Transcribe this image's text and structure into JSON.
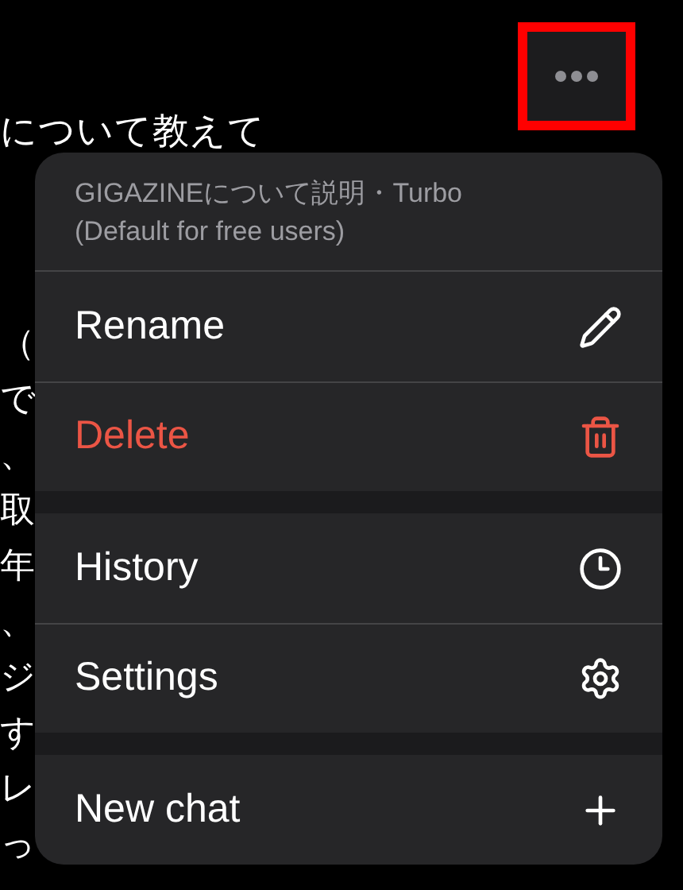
{
  "background_text": {
    "lines": [
      "について教えて",
      "（",
      "で",
      "、",
      "取",
      "年",
      "、",
      "ジ",
      "す",
      "レ",
      "っ"
    ]
  },
  "more_button": {
    "highlighted": true
  },
  "menu": {
    "header": {
      "title": "GIGAZINEについて説明・Turbo",
      "subtitle": "(Default for free users)"
    },
    "sections": [
      {
        "items": [
          {
            "label": "Rename",
            "kind": "pencil",
            "destructive": false
          },
          {
            "label": "Delete",
            "kind": "trash",
            "destructive": true
          }
        ]
      },
      {
        "items": [
          {
            "label": "History",
            "kind": "clock",
            "destructive": false
          },
          {
            "label": "Settings",
            "kind": "gear",
            "destructive": false
          }
        ]
      },
      {
        "items": [
          {
            "label": "New chat",
            "kind": "plus",
            "destructive": false
          }
        ]
      }
    ]
  }
}
